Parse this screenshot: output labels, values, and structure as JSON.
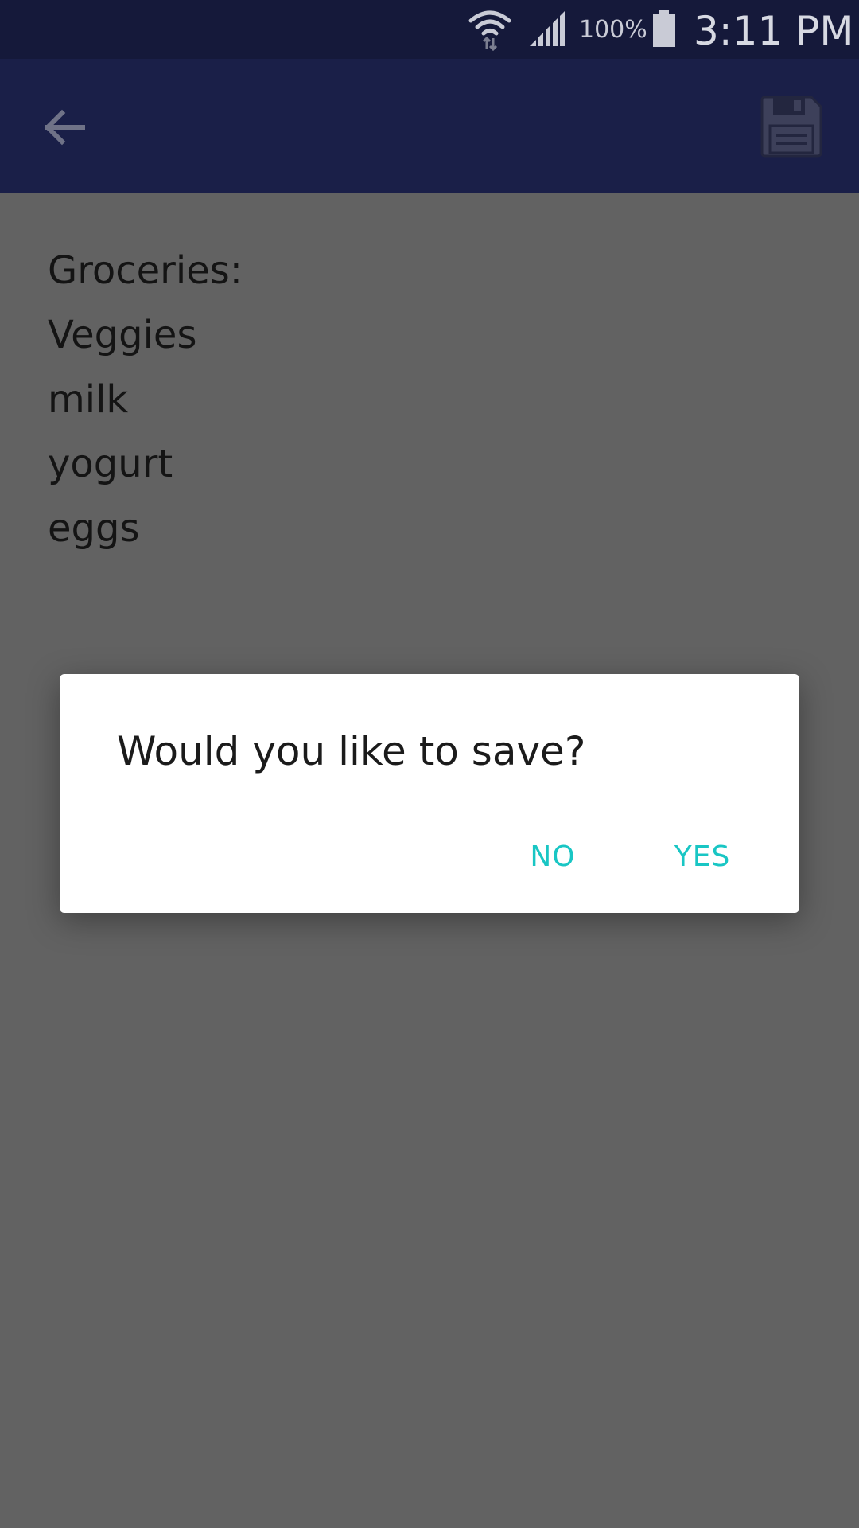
{
  "status_bar": {
    "battery_percent": "100%",
    "time": "3:11 PM",
    "icons": [
      "wifi-icon",
      "cell-signal-icon",
      "battery-icon"
    ]
  },
  "app_bar": {
    "icons": [
      "back-arrow-icon",
      "floppy-save-icon"
    ]
  },
  "note": {
    "lines": [
      "Groceries:",
      "Veggies",
      "milk",
      "yogurt",
      "eggs"
    ]
  },
  "dialog": {
    "message": "Would you like to save?",
    "no_label": "NO",
    "yes_label": "YES"
  },
  "colors": {
    "status_bar": "#15193a",
    "app_bar": "#1a1f48",
    "scrim_background": "#626262",
    "dialog_button": "#19c6c4"
  }
}
